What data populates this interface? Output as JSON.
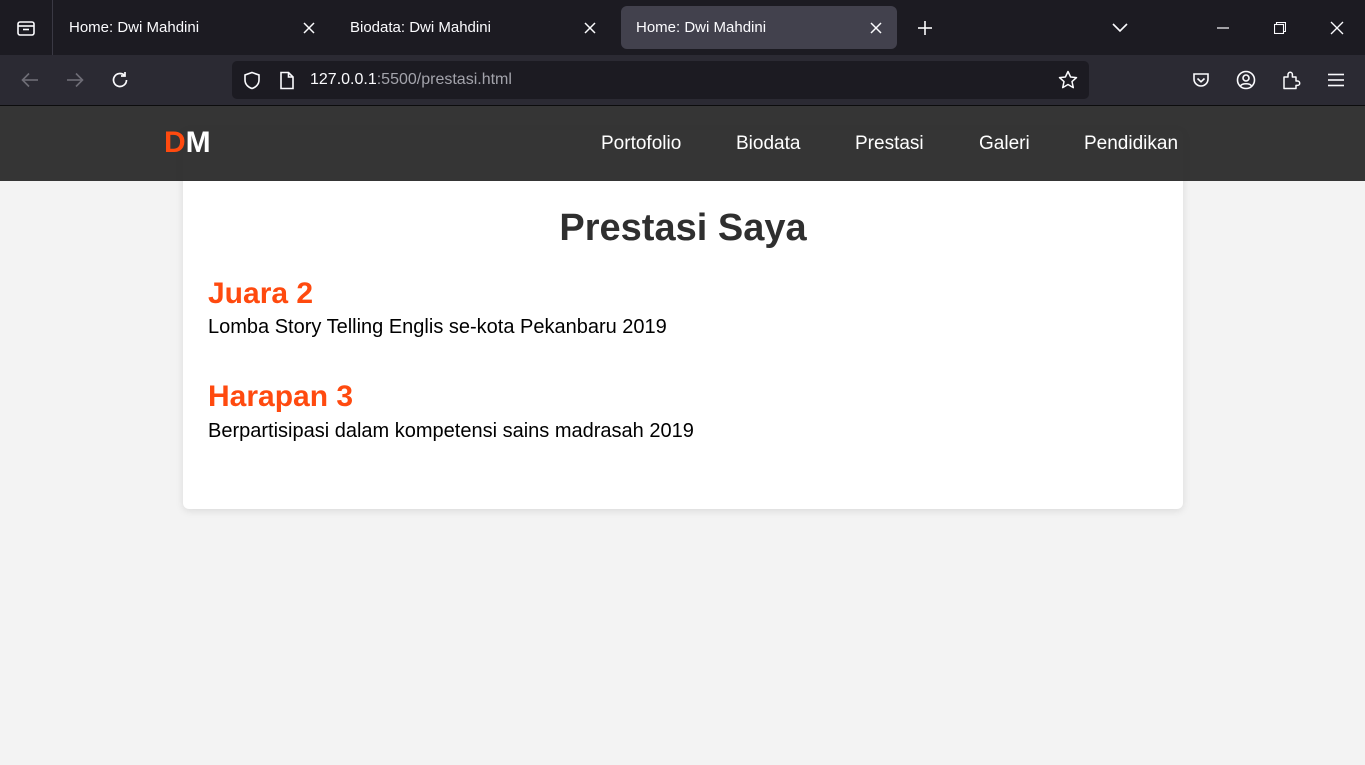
{
  "browser": {
    "tabs": [
      {
        "title": "Home: Dwi Mahdini",
        "active": false
      },
      {
        "title": "Biodata: Dwi Mahdini",
        "active": false
      },
      {
        "title": "Home: Dwi Mahdini",
        "active": true
      }
    ],
    "url": {
      "host": "127.0.0.1",
      "rest": ":5500/prestasi.html"
    },
    "icons": [
      "tab-list-icon",
      "close-icon",
      "plus-icon",
      "chevron-down-icon",
      "minimize-icon",
      "restore-icon",
      "close-window-icon",
      "back-arrow-icon",
      "forward-arrow-icon",
      "reload-icon",
      "shield-icon",
      "page-icon",
      "star-icon",
      "pocket-icon",
      "account-icon",
      "extensions-icon",
      "menu-icon"
    ]
  },
  "site": {
    "logo": {
      "d": "D",
      "m": "M"
    },
    "nav": [
      "Portofolio",
      "Biodata",
      "Prestasi",
      "Galeri",
      "Pendidikan"
    ],
    "page_title": "Prestasi Saya",
    "achievements": [
      {
        "title": "Juara 2",
        "desc": "Lomba Story Telling Englis se-kota Pekanbaru 2019"
      },
      {
        "title": "Harapan 3",
        "desc": "Berpartisipasi dalam kompetensi sains madrasah 2019"
      }
    ],
    "colors": {
      "accent": "#ff4a0f",
      "header_bg": "#262626",
      "page_bg": "#f3f3f3"
    }
  }
}
